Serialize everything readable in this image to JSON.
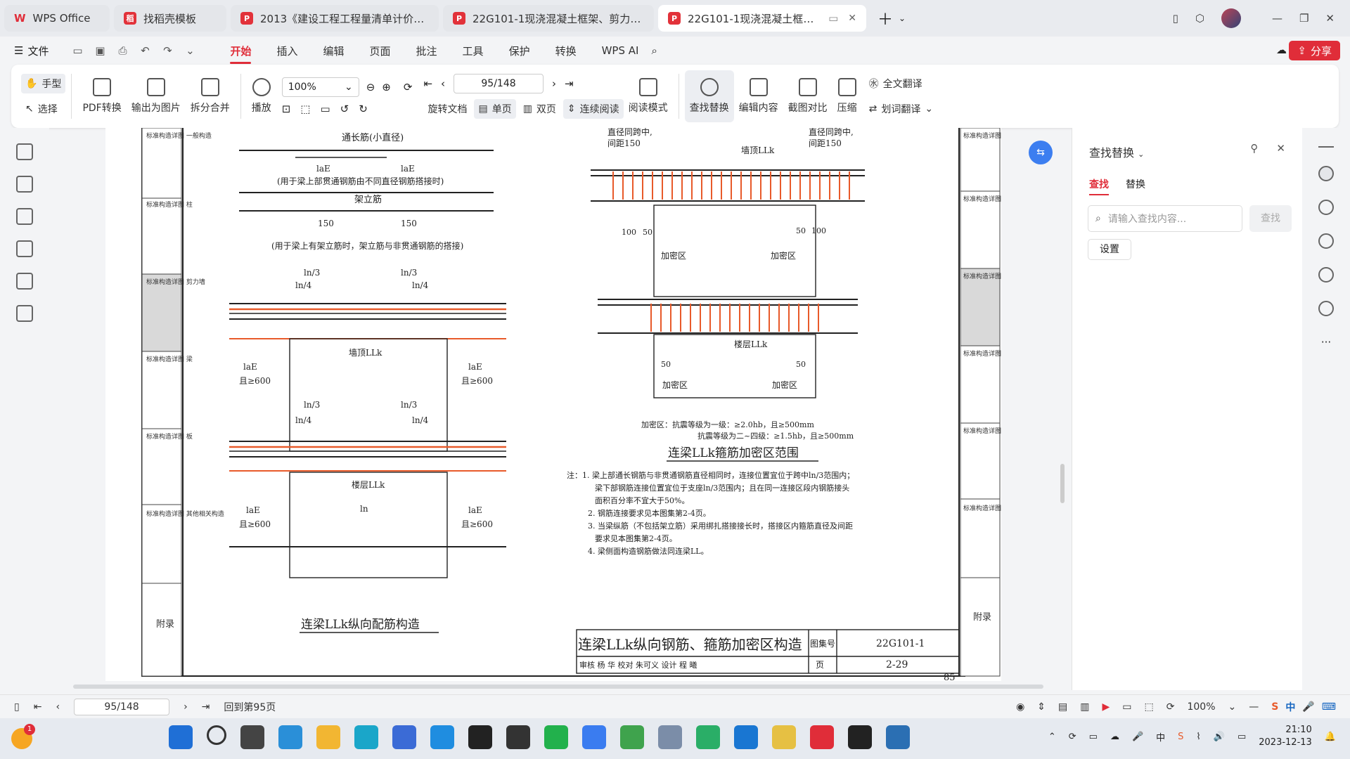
{
  "tabs": [
    {
      "label": "WPS Office",
      "icon": "wps-logo-icon"
    },
    {
      "label": "找稻壳模板",
      "icon": "docer-icon"
    },
    {
      "label": "2013《建设工程工程量清单计价规范",
      "icon": "pdf-icon"
    },
    {
      "label": "22G101-1现浇混凝土框架、剪力墙、",
      "icon": "pdf-icon"
    },
    {
      "label": "22G101-1现浇混凝土框架、剪",
      "icon": "pdf-icon",
      "active": true
    }
  ],
  "menubar": {
    "file": "文件",
    "items": [
      "开始",
      "插入",
      "编辑",
      "页面",
      "批注",
      "工具",
      "保护",
      "转换",
      "WPS AI"
    ],
    "active": "开始",
    "share": "分享"
  },
  "ribbon": {
    "hand": "手型",
    "select": "选择",
    "pdf_convert": "PDF转换",
    "export_image": "输出为图片",
    "split_merge": "拆分合并",
    "play": "播放",
    "zoom": "100%",
    "page": "95/148",
    "rotate": "旋转文档",
    "single": "单页",
    "double": "双页",
    "continuous": "连续阅读",
    "read_mode": "阅读模式",
    "find_replace": "查找替换",
    "edit_content": "编辑内容",
    "screenshot_compare": "截图对比",
    "compress": "压缩",
    "full_translate": "全文翻译",
    "word_translate": "划词翻译"
  },
  "doc": {
    "side_tabs_left": [
      "标准构造详图 一般构造",
      "标准构造详图 柱",
      "标准构造详图 剪力墙",
      "标准构造详图 梁",
      "标准构造详图 板",
      "标准构造详图 其他相关构造",
      "附录"
    ],
    "top_label_a": "通长筋(小直径)",
    "note_a": "(用于梁上部贯通钢筋由不同直径钢筋搭接时)",
    "label_jlj": "架立筋",
    "note_b": "(用于梁上有架立筋时，架立筋与非贯通钢筋的搭接)",
    "dim_150": "150",
    "ln3": "ln/3",
    "ln4": "ln/4",
    "lae": "laE",
    "ge600": "且≥600",
    "ln": "ln",
    "wall_top": "墙顶LLk",
    "floor_llk": "楼层LLk",
    "caption_left": "连梁LLk纵向配筋构造",
    "same_dia": "直径同跨中,",
    "spacing": "间距150",
    "dim_100": "100",
    "dim_50": "50",
    "dense": "加密区",
    "dense_note1": "加密区：抗震等级为一级：≥2.0hb，且≥500mm",
    "dense_note2": "抗震等级为二~四级：≥1.5hb，且≥500mm",
    "caption_right": "连梁LLk箍筋加密区范围",
    "notes": [
      "注：1. 梁上部通长钢筋与非贯通钢筋直径相同时，连接位置宜位于跨中ln/3范围内；",
      "梁下部钢筋连接位置宜位于支座ln/3范围内；且在同一连接区段内钢筋接头",
      "面积百分率不宜大于50%。",
      "2. 钢筋连接要求见本图集第2-4页。",
      "3. 当梁纵筋（不包括架立筋）采用绑扎搭接接长时，搭接区内箍筋直径及间距",
      "要求见本图集第2-4页。",
      "4. 梁侧面构造钢筋做法同连梁LL。"
    ],
    "title_block": {
      "title": "连梁LLk纵向钢筋、箍筋加密区构造",
      "atlas_label": "图集号",
      "atlas_no": "22G101-1",
      "page_label": "页",
      "page_no": "2-29",
      "sign_row": "审核 杨 华  校对 朱可义  设计 程 曦"
    },
    "page_number": "85"
  },
  "panel": {
    "title": "查找替换",
    "tab_find": "查找",
    "tab_replace": "替换",
    "placeholder": "请输入查找内容...",
    "find_btn": "查找",
    "settings": "设置"
  },
  "status": {
    "page": "95/148",
    "back": "回到第95页",
    "zoom": "100%",
    "ime": "中"
  },
  "taskbar": {
    "time": "21:10",
    "date": "2023-12-13",
    "badge": "1"
  },
  "colors": {
    "accent": "#e02d39",
    "rebar": "#e85a2a"
  }
}
